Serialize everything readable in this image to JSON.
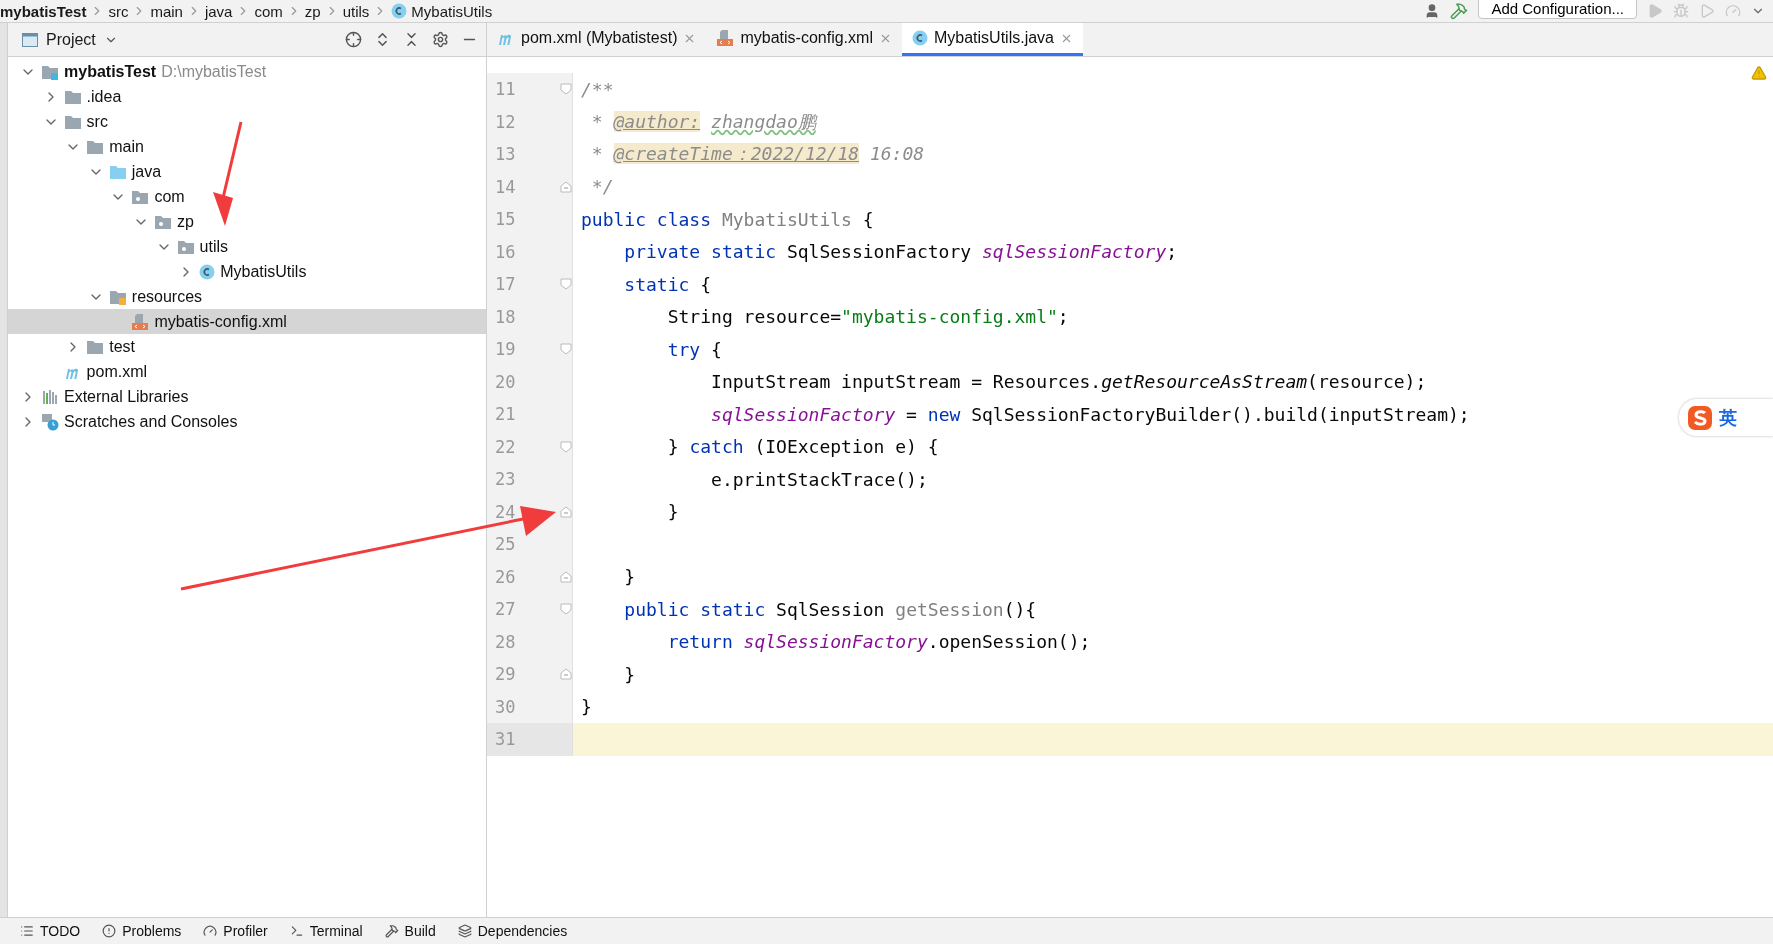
{
  "breadcrumb": [
    {
      "label": "mybatisTest",
      "kind": "bold"
    },
    {
      "label": "src",
      "kind": "plain"
    },
    {
      "label": "main",
      "kind": "plain"
    },
    {
      "label": "java",
      "kind": "plain"
    },
    {
      "label": "com",
      "kind": "plain"
    },
    {
      "label": "zp",
      "kind": "plain"
    },
    {
      "label": "utils",
      "kind": "plain"
    },
    {
      "label": "MybatisUtils",
      "kind": "class"
    }
  ],
  "toolbar": {
    "config_button": "Add Configuration..."
  },
  "project_panel": {
    "title": "Project",
    "tree": [
      {
        "label": "mybatisTest",
        "path": "D:\\mybatisTest",
        "kind": "module",
        "expanded": true,
        "selected": false,
        "children": [
          {
            "label": ".idea",
            "kind": "folder",
            "expanded": false,
            "selected": false
          },
          {
            "label": "src",
            "kind": "folder",
            "expanded": true,
            "selected": false,
            "children": [
              {
                "label": "main",
                "kind": "folder",
                "expanded": true,
                "selected": false,
                "children": [
                  {
                    "label": "java",
                    "kind": "source",
                    "expanded": true,
                    "selected": false,
                    "children": [
                      {
                        "label": "com",
                        "kind": "package",
                        "expanded": true,
                        "selected": false,
                        "children": [
                          {
                            "label": "zp",
                            "kind": "package",
                            "expanded": true,
                            "selected": false,
                            "children": [
                              {
                                "label": "utils",
                                "kind": "package",
                                "expanded": true,
                                "selected": false,
                                "children": [
                                  {
                                    "label": "MybatisUtils",
                                    "kind": "class",
                                    "expanded": false,
                                    "selected": false
                                  }
                                ]
                              }
                            ]
                          }
                        ]
                      }
                    ]
                  },
                  {
                    "label": "resources",
                    "kind": "resources",
                    "expanded": true,
                    "selected": false,
                    "children": [
                      {
                        "label": "mybatis-config.xml",
                        "kind": "xml",
                        "selected": true
                      }
                    ]
                  }
                ]
              },
              {
                "label": "test",
                "kind": "folder",
                "expanded": false,
                "selected": false
              }
            ]
          },
          {
            "label": "pom.xml",
            "kind": "maven",
            "selected": false
          }
        ]
      },
      {
        "label": "External Libraries",
        "kind": "libraries",
        "expanded": false,
        "selected": false
      },
      {
        "label": "Scratches and Consoles",
        "kind": "scratches",
        "expanded": false,
        "selected": false
      }
    ]
  },
  "editor_tabs": [
    {
      "label": "pom.xml (Mybatistest)",
      "kind": "maven",
      "selected": false
    },
    {
      "label": "mybatis-config.xml",
      "kind": "xml",
      "selected": false
    },
    {
      "label": "MybatisUtils.java",
      "kind": "class",
      "selected": true
    }
  ],
  "code_lines": [
    {
      "number": "11",
      "fold_start": true,
      "fold_end": false,
      "current": false,
      "tokens": [
        {
          "kind": "comment",
          "text": "/**"
        }
      ]
    },
    {
      "number": "12",
      "fold_start": false,
      "fold_end": false,
      "current": false,
      "tokens": [
        {
          "kind": "comment",
          "text": " * "
        },
        {
          "kind": "doctag",
          "text": "@author:"
        },
        {
          "kind": "typo",
          "text": "zhangdao鹏"
        }
      ]
    },
    {
      "number": "13",
      "fold_start": false,
      "fold_end": false,
      "current": false,
      "tokens": [
        {
          "kind": "comment",
          "text": " * "
        },
        {
          "kind": "doctag",
          "text": "@createTime：2022/12/18"
        },
        {
          "kind": "comment",
          "text": " 16:08"
        }
      ]
    },
    {
      "number": "14",
      "fold_start": false,
      "fold_end": true,
      "current": false,
      "tokens": [
        {
          "kind": "comment",
          "text": " */"
        }
      ]
    },
    {
      "number": "15",
      "fold_start": false,
      "fold_end": false,
      "current": false,
      "tokens": [
        {
          "kind": "keyword",
          "text": "public class "
        },
        {
          "kind": "unused",
          "text": "MybatisUtils"
        },
        {
          "kind": "plain",
          "text": " {"
        }
      ]
    },
    {
      "number": "16",
      "fold_start": false,
      "fold_end": false,
      "current": false,
      "tokens": [
        {
          "kind": "keyword",
          "text": "    private static "
        },
        {
          "kind": "plain",
          "text": "SqlSessionFactory "
        },
        {
          "kind": "field",
          "text": "sqlSessionFactory"
        },
        {
          "kind": "plain",
          "text": ";"
        }
      ]
    },
    {
      "number": "17",
      "fold_start": true,
      "fold_end": false,
      "current": false,
      "tokens": [
        {
          "kind": "keyword",
          "text": "    static "
        },
        {
          "kind": "plain",
          "text": "{"
        }
      ]
    },
    {
      "number": "18",
      "fold_start": false,
      "fold_end": false,
      "current": false,
      "tokens": [
        {
          "kind": "plain",
          "text": "        String resource="
        },
        {
          "kind": "string",
          "text": "\"mybatis-config.xml\""
        },
        {
          "kind": "plain",
          "text": ";"
        }
      ]
    },
    {
      "number": "19",
      "fold_start": true,
      "fold_end": false,
      "current": false,
      "tokens": [
        {
          "kind": "keyword",
          "text": "        try "
        },
        {
          "kind": "plain",
          "text": "{"
        }
      ]
    },
    {
      "number": "20",
      "fold_start": false,
      "fold_end": false,
      "current": false,
      "tokens": [
        {
          "kind": "plain",
          "text": "            InputStream inputStream = Resources."
        },
        {
          "kind": "static",
          "text": "getResourceAsStream"
        },
        {
          "kind": "plain",
          "text": "(resource);"
        }
      ]
    },
    {
      "number": "21",
      "fold_start": false,
      "fold_end": false,
      "current": false,
      "tokens": [
        {
          "kind": "field",
          "text": "            sqlSessionFactory"
        },
        {
          "kind": "plain",
          "text": " = "
        },
        {
          "kind": "keyword",
          "text": "new "
        },
        {
          "kind": "plain",
          "text": "SqlSessionFactoryBuilder().build(inputStream);"
        }
      ]
    },
    {
      "number": "22",
      "fold_start": true,
      "fold_end": false,
      "current": false,
      "tokens": [
        {
          "kind": "plain",
          "text": "        } "
        },
        {
          "kind": "keyword",
          "text": "catch "
        },
        {
          "kind": "plain",
          "text": "(IOException e) {"
        }
      ]
    },
    {
      "number": "23",
      "fold_start": false,
      "fold_end": false,
      "current": false,
      "tokens": [
        {
          "kind": "plain",
          "text": "            e.printStackTrace();"
        }
      ]
    },
    {
      "number": "24",
      "fold_start": false,
      "fold_end": true,
      "current": false,
      "tokens": [
        {
          "kind": "plain",
          "text": "        }"
        }
      ]
    },
    {
      "number": "25",
      "fold_start": false,
      "fold_end": false,
      "current": false
    },
    {
      "number": "26",
      "fold_start": false,
      "fold_end": true,
      "current": false,
      "tokens": [
        {
          "kind": "plain",
          "text": "    }"
        }
      ]
    },
    {
      "number": "27",
      "fold_start": true,
      "fold_end": false,
      "current": false,
      "tokens": [
        {
          "kind": "keyword",
          "text": "    public static "
        },
        {
          "kind": "plain",
          "text": "SqlSession "
        },
        {
          "kind": "unused",
          "text": "getSession"
        },
        {
          "kind": "plain",
          "text": "(){"
        }
      ]
    },
    {
      "number": "28",
      "fold_start": false,
      "fold_end": false,
      "current": false,
      "tokens": [
        {
          "kind": "keyword",
          "text": "        return "
        },
        {
          "kind": "field",
          "text": "sqlSessionFactory"
        },
        {
          "kind": "plain",
          "text": ".openSession();"
        }
      ]
    },
    {
      "number": "29",
      "fold_start": false,
      "fold_end": true,
      "current": false,
      "tokens": [
        {
          "kind": "plain",
          "text": "    }"
        }
      ]
    },
    {
      "number": "30",
      "fold_start": false,
      "fold_end": false,
      "current": false,
      "tokens": [
        {
          "kind": "plain",
          "text": "}"
        }
      ]
    },
    {
      "number": "31",
      "fold_start": false,
      "fold_end": false,
      "current": true
    }
  ],
  "ime_widget": {
    "label": "英"
  },
  "bottom_tools": [
    {
      "label": "TODO",
      "kind": "todo"
    },
    {
      "label": "Problems",
      "kind": "problems"
    },
    {
      "label": "Profiler",
      "kind": "profiler"
    },
    {
      "label": "Terminal",
      "kind": "terminal"
    },
    {
      "label": "Build",
      "kind": "build"
    },
    {
      "label": "Dependencies",
      "kind": "dependencies"
    }
  ]
}
